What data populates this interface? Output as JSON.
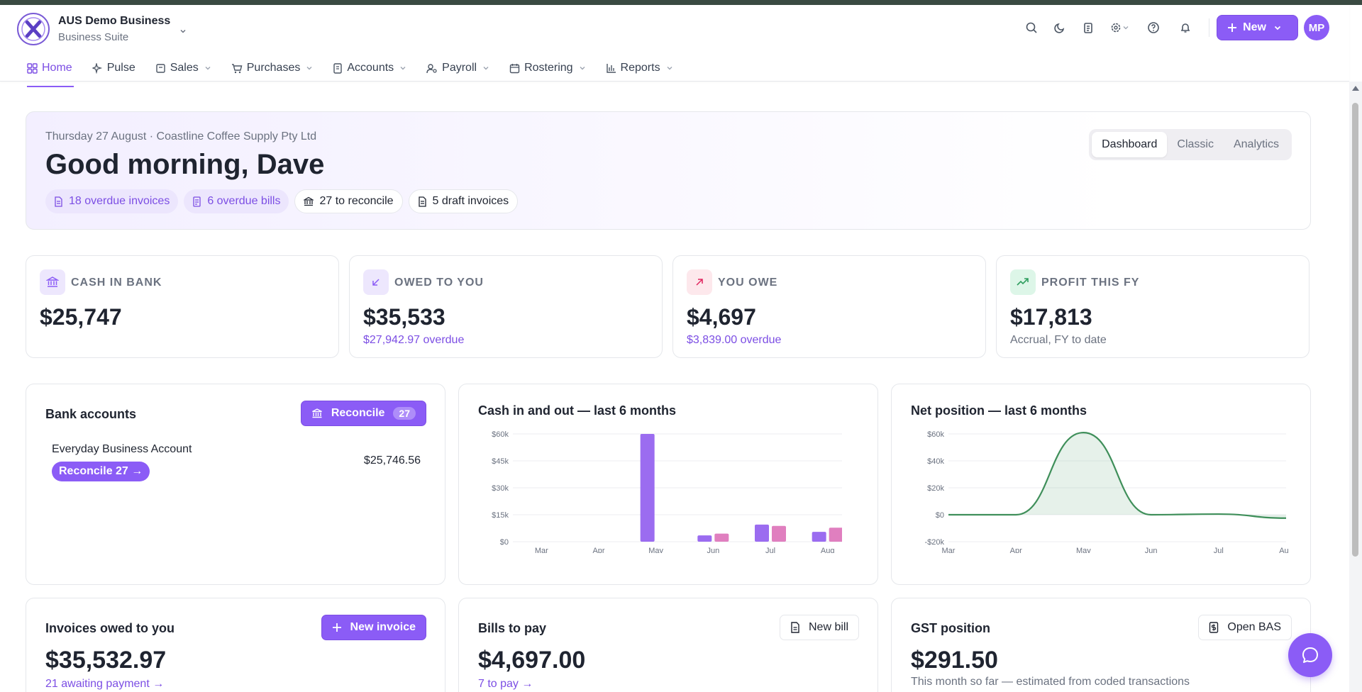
{
  "brand": {
    "name": "AUS Demo Business",
    "subtitle": "Business Suite",
    "logo_icon": "x-logo"
  },
  "header": {
    "new_label": "New",
    "avatar_initials": "MP"
  },
  "nav": [
    {
      "label": "Home",
      "icon": "grid-icon",
      "active": true
    },
    {
      "label": "Pulse",
      "icon": "sparkle-icon"
    },
    {
      "label": "Sales",
      "icon": "receipt-icon"
    },
    {
      "label": "Purchases",
      "icon": "cart-icon"
    },
    {
      "label": "Accounts",
      "icon": "ledger-icon"
    },
    {
      "label": "Payroll",
      "icon": "user-cog-icon"
    },
    {
      "label": "Rostering",
      "icon": "calendar-icon"
    },
    {
      "label": "Reports",
      "icon": "bar-chart-icon"
    }
  ],
  "hero": {
    "date_line": "Thursday 27 August · Coastline Coffee Supply Pty Ltd",
    "greeting": "Good morning, Dave",
    "chips": [
      "18 overdue invoices",
      "6 overdue bills",
      "27 to reconcile",
      "5 draft invoices"
    ],
    "views": [
      "Dashboard",
      "Classic",
      "Analytics"
    ],
    "active_view": "Dashboard"
  },
  "kpis": [
    {
      "label": "CASH IN BANK",
      "value": "$25,747",
      "sub": ""
    },
    {
      "label": "OWED TO YOU",
      "value": "$35,533",
      "sub": "$27,942.97 overdue"
    },
    {
      "label": "YOU OWE",
      "value": "$4,697",
      "sub": "$3,839.00 overdue"
    },
    {
      "label": "PROFIT THIS FY",
      "value": "$17,813",
      "sub": "Accrual, FY to date"
    }
  ],
  "bank": {
    "title": "Bank accounts",
    "reconcile_label": "Reconcile",
    "reconcile_count": "27",
    "account_name": "Everyday Business Account",
    "account_reconcile": "Reconcile 27 →",
    "balance": "$25,746.56"
  },
  "cashflow": {
    "title": "Cash in and out — last 6 months"
  },
  "netpos": {
    "title": "Net position — last 6 months"
  },
  "invoices": {
    "title": "Invoices owed to you",
    "button": "New invoice",
    "value": "$35,532.97",
    "link": "21 awaiting payment →"
  },
  "bills": {
    "title": "Bills to pay",
    "button": "New bill",
    "value": "$4,697.00",
    "link": "7 to pay →"
  },
  "gst": {
    "title": "GST position",
    "button": "Open BAS",
    "value": "$291.50",
    "note": "This month so far — estimated from coded transactions"
  },
  "colors": {
    "accent": "#8b5cf6",
    "cash_in": "#9b6cf0",
    "cash_out": "#e07fbf",
    "net_line": "#3f8f5a"
  },
  "chart_data": [
    {
      "type": "bar",
      "title": "Cash in and out — last 6 months",
      "categories": [
        "Mar",
        "Apr",
        "May",
        "Jun",
        "Jul",
        "Aug"
      ],
      "ylim": [
        0,
        60000
      ],
      "yticks": [
        "$0",
        "$15k",
        "$30k",
        "$45k",
        "$60k"
      ],
      "series": [
        {
          "values": [
            0,
            0,
            60000,
            3500,
            9500,
            5500
          ]
        },
        {
          "values": [
            0,
            0,
            0,
            4500,
            8800,
            7800
          ]
        }
      ],
      "grid": true
    },
    {
      "type": "area",
      "title": "Net position — last 6 months",
      "categories": [
        "Mar",
        "Apr",
        "May",
        "Jun",
        "Jul",
        "Aug"
      ],
      "ylim": [
        -20000,
        60000
      ],
      "yticks": [
        "-$20k",
        "$0",
        "$20k",
        "$40k",
        "$60k"
      ],
      "values": [
        0,
        0,
        61000,
        0,
        500,
        -2500
      ],
      "grid": true
    }
  ]
}
